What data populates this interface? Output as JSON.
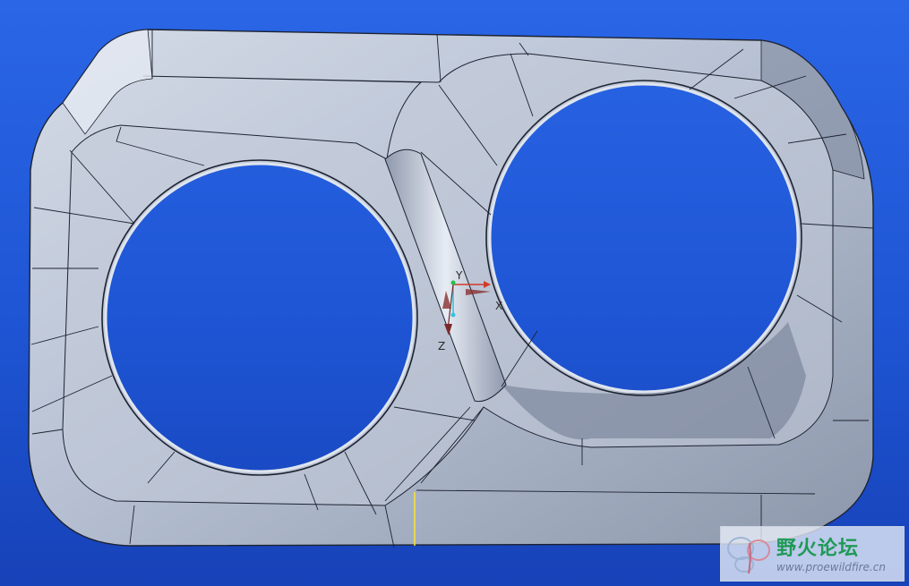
{
  "viewport": {
    "background_top": "#2a66e6",
    "background_bottom": "#1742b8"
  },
  "model": {
    "surface_color": "#b8c2d4",
    "edge_color": "#1d2230",
    "hole_count": 2
  },
  "coordinate_system": {
    "x_label": "X",
    "y_label": "Y",
    "z_label": "Z",
    "x_color": "#d23a2a",
    "y_color": "#22c24a",
    "z_color": "#32c4e0"
  },
  "watermark": {
    "title": "野火论坛",
    "url": "www.proewildfire.cn",
    "title_color": "#1f9a55"
  }
}
